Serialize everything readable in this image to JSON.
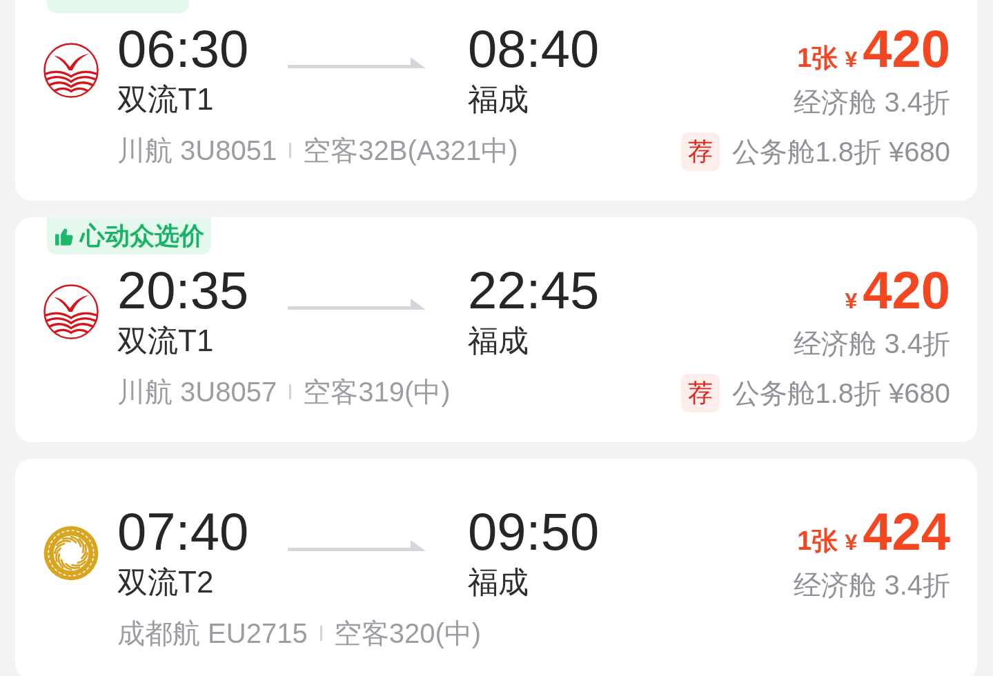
{
  "flights": [
    {
      "kind": "bird",
      "badge": true,
      "depart_time": "06:30",
      "depart_airport": "双流T1",
      "arrive_time": "08:40",
      "arrive_airport": "福成",
      "flight": "川航 3U8051",
      "aircraft": "空客32B(A321中)",
      "tickets_left": "1张",
      "currency": "¥",
      "price": "420",
      "cabin": "经济舱 3.4折",
      "recommend": {
        "tag": "荐",
        "text": "公务舱1.8折 ¥680"
      }
    },
    {
      "kind": "bird",
      "badge": true,
      "badge_text": "心动众选价",
      "depart_time": "20:35",
      "depart_airport": "双流T1",
      "arrive_time": "22:45",
      "arrive_airport": "福成",
      "flight": "川航 3U8057",
      "aircraft": "空客319(中)",
      "currency": "¥",
      "price": "420",
      "cabin": "经济舱 3.4折",
      "recommend": {
        "tag": "荐",
        "text": "公务舱1.8折 ¥680"
      }
    },
    {
      "kind": "swirl",
      "badge": false,
      "depart_time": "07:40",
      "depart_airport": "双流T2",
      "arrive_time": "09:50",
      "arrive_airport": "福成",
      "flight": "成都航 EU2715",
      "aircraft": "空客320(中)",
      "tickets_left": "1张",
      "currency": "¥",
      "price": "424",
      "cabin": "经济舱 3.4折"
    }
  ]
}
